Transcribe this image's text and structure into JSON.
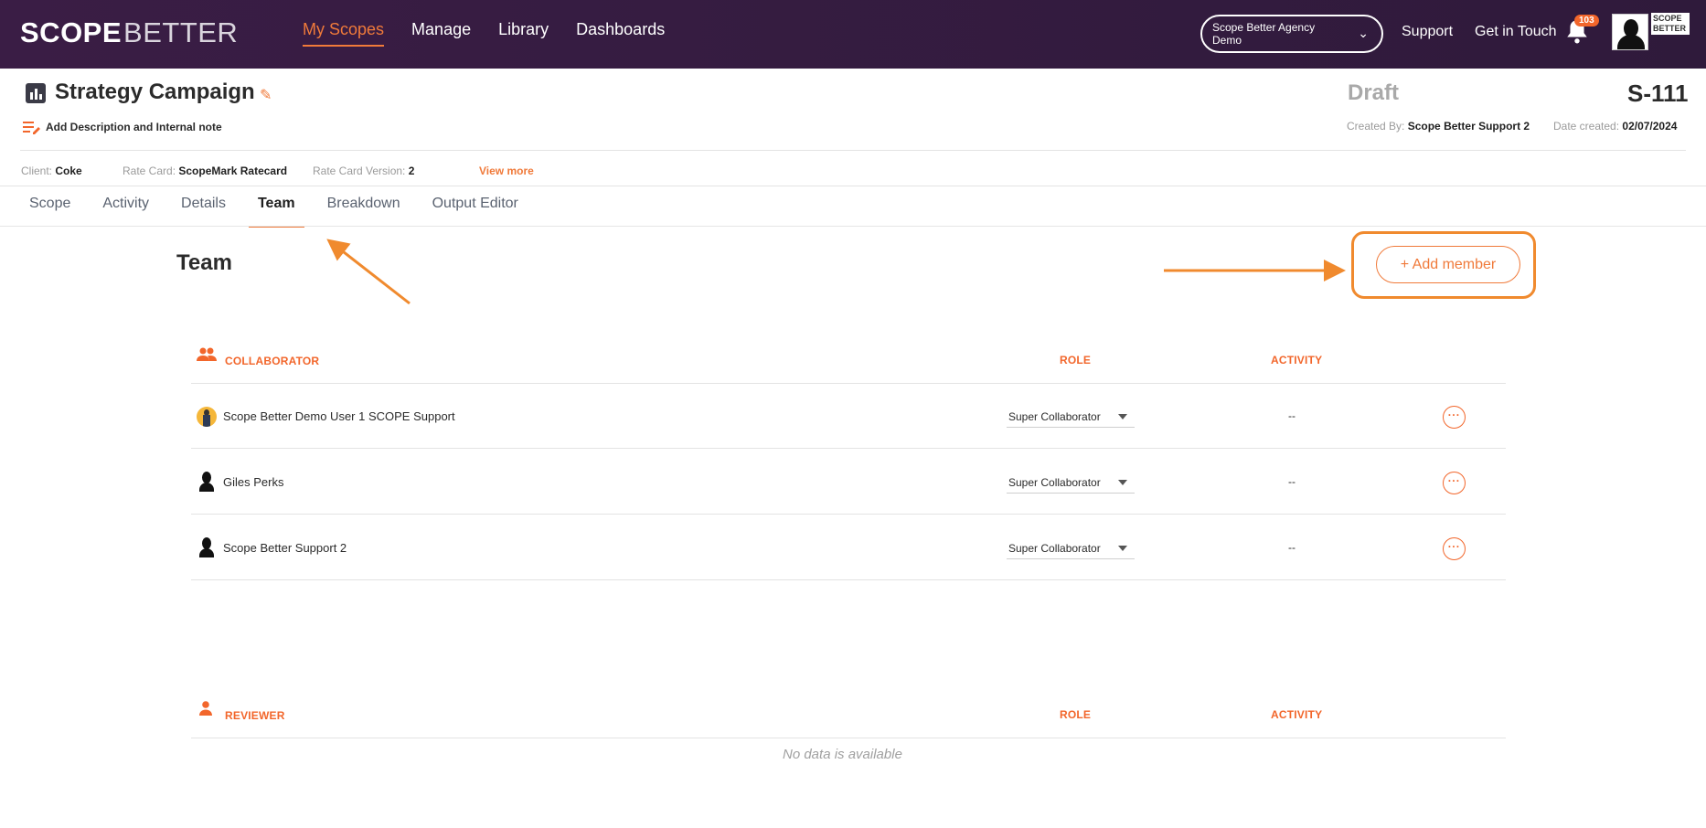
{
  "brand": {
    "logo_scope": "SCOPE",
    "logo_better": "BETTER",
    "mini_logo": "SCOPE BETTER"
  },
  "nav": {
    "items": [
      "My Scopes",
      "Manage",
      "Library",
      "Dashboards"
    ],
    "active": "My Scopes",
    "agency_select": "Scope Better Agency Demo",
    "support": "Support",
    "get_in_touch": "Get in Touch",
    "notifications_count": "103"
  },
  "header": {
    "title": "Strategy Campaign",
    "add_description": "Add Description and Internal note",
    "status": "Draft",
    "code": "S-111",
    "created_by_label": "Created By:",
    "created_by": "Scope Better Support 2",
    "date_created_label": "Date created:",
    "date_created": "02/07/2024",
    "client_label": "Client:",
    "client": "Coke",
    "rate_card_label": "Rate Card:",
    "rate_card": "ScopeMark Ratecard",
    "rate_card_version_label": "Rate Card Version:",
    "rate_card_version": "2",
    "view_more": "View more"
  },
  "tabs": [
    "Scope",
    "Activity",
    "Details",
    "Team",
    "Breakdown",
    "Output Editor"
  ],
  "active_tab": "Team",
  "team": {
    "title": "Team",
    "add_member": "+ Add member",
    "collaborators": {
      "header": "COLLABORATOR",
      "role_header": "ROLE",
      "activity_header": "ACTIVITY",
      "rows": [
        {
          "name": "Scope Better Demo User 1 SCOPE Support",
          "role": "Super Collaborator",
          "activity": "--"
        },
        {
          "name": "Giles Perks",
          "role": "Super Collaborator",
          "activity": "--"
        },
        {
          "name": "Scope Better Support 2",
          "role": "Super Collaborator",
          "activity": "--"
        }
      ]
    },
    "reviewers": {
      "header": "REVIEWER",
      "role_header": "ROLE",
      "activity_header": "ACTIVITY",
      "empty_text": "No data is available"
    }
  },
  "colors": {
    "accent": "#f2662b",
    "nav_bg": "#3a1d45",
    "annotation": "#f08a2e"
  }
}
